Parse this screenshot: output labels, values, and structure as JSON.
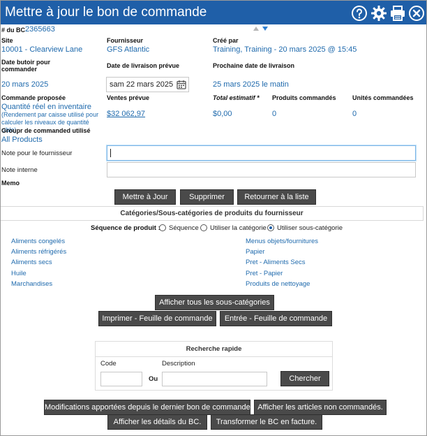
{
  "header": {
    "title": "Mettre à jour le bon de commande",
    "icons": [
      "help-icon",
      "gear-icon",
      "print-icon",
      "close-icon"
    ],
    "color": "#1f5fa8"
  },
  "po": {
    "number_label": "# du BC",
    "number": "2365663",
    "site_label": "Site",
    "site": "10001 - Clearview Lane",
    "supplier_label": "Fournisseur",
    "supplier": "GFS Atlantic",
    "created_label": "Créé par",
    "created": "Training, Training - 20 mars 2025 @ 15:45",
    "due_label": "Date butoir pour commander",
    "due": "20 mars 2025",
    "delivery_label": "Date de livraison prévue",
    "delivery": "sam 22 mars 2025",
    "next_delivery_label": "Prochaine date de livraison",
    "next_delivery": "25 mars 2025 le matin"
  },
  "totals": {
    "proposed_label": "Commande proposée",
    "proposed": "Quantité réel en inventaire",
    "proposed_note": "(Rendement par caisse utilisé pour calculer les niveaux de quantité cible)",
    "sales_label": "Ventes prévue",
    "sales": "$32 062,97",
    "total_label": "Total estimatif *",
    "total": "$0,00",
    "products_label": "Produits commandés",
    "products": "0",
    "units_label": "Unités commandées",
    "units": "0",
    "group_label": "Groupr de commanded utilisé",
    "group": "All Products"
  },
  "notes": {
    "supplier_label": "Note pour le fournisseur",
    "internal_label": "Note interne",
    "memo_label": "Memo"
  },
  "actions": {
    "update": "Mettre à Jour",
    "delete": "Supprimer",
    "back": "Retourner à la liste"
  },
  "categories": {
    "heading": "Catégories/Sous-catégories de produits du fournisseur",
    "sequence_label": "Séquence de produit :",
    "options": [
      "Séquence",
      "Utiliser la catégorie",
      "Utiliser sous-catégorie"
    ],
    "left": [
      "Aliments congelés",
      "Aliments réfrigérés",
      "Aliments secs",
      "Huile",
      "Marchandises"
    ],
    "right": [
      "Menus objets/fournitures",
      "Papier",
      "Pret - Aliments Secs",
      "Pret - Papier",
      "Produits de nettoyage"
    ],
    "show_all": "Afficher tous les sous-catégories",
    "print_sheet": "Imprimer - Feuille de commande",
    "entry_sheet": "Entrée - Feuille de commande"
  },
  "search": {
    "title": "Recherche rapide",
    "code_label": "Code",
    "or_label": "Ou",
    "desc_label": "Description",
    "button": "Chercher"
  },
  "footer": {
    "changes": "Modifications apportées depuis le dernier bon de commande.",
    "unordered": "Afficher les articles non commandés.",
    "details": "Afficher les détails du BC.",
    "invoice": "Transformer le BC en facture."
  }
}
